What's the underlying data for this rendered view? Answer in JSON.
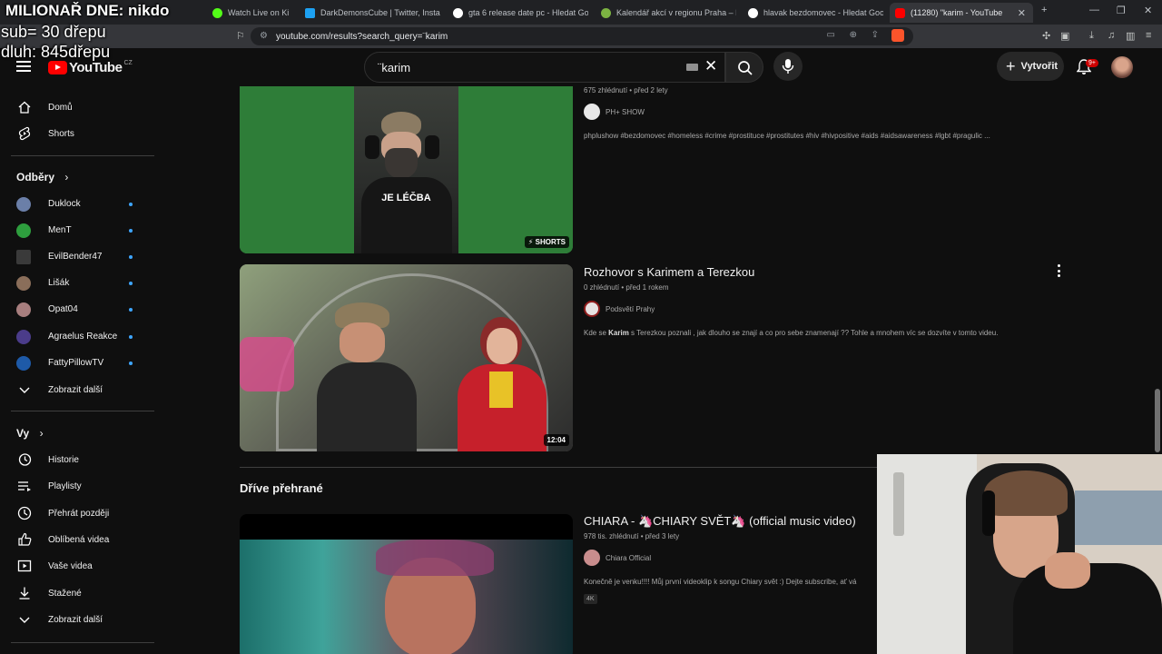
{
  "overlay": {
    "title": "MILIONAŘ DNE: nikdo",
    "line1": "sub= 30 dřepu",
    "line2": "dluh: 845dřepu"
  },
  "browser": {
    "tabs": [
      {
        "label": "Watch Live on Ki",
        "color": "#53fc18"
      },
      {
        "label": "DarkDemonsCube | Twitter, Instagra",
        "color": "#1da1f2"
      },
      {
        "label": "gta 6 release date pc - Hledat Goog",
        "color": "#ffffff"
      },
      {
        "label": "Kalendář akcí v regionu Praha – Kudy",
        "color": "#7cb342"
      },
      {
        "label": "hlavak bezdomovec - Hledat Google",
        "color": "#ffffff"
      },
      {
        "label": "(11280) \"karim - YouTube",
        "color": "#ff0000"
      }
    ],
    "url": "youtube.com/results?search_query=¨karim"
  },
  "header": {
    "logo_text": "YouTube",
    "logo_country": "CZ",
    "search_value": "¨karim",
    "create_label": "Vytvořit",
    "notification_count": "9+"
  },
  "sidebar": {
    "main": [
      {
        "label": "Domů",
        "icon": "home-icon"
      },
      {
        "label": "Shorts",
        "icon": "shorts-icon"
      }
    ],
    "subscriptions_heading": "Odběry",
    "subscriptions": [
      {
        "label": "Duklock",
        "color": "#6b7fa8"
      },
      {
        "label": "MenT",
        "color": "#2e9e3e"
      },
      {
        "label": "EvilBender47",
        "color": "#3a3a3a"
      },
      {
        "label": "Lišák",
        "color": "#8a6e5a"
      },
      {
        "label": "Opat04",
        "color": "#a77e7e"
      },
      {
        "label": "Agraelus Reakce",
        "color": "#4b3c8a"
      },
      {
        "label": "FattyPillowTV",
        "color": "#1e5aa8"
      }
    ],
    "show_more": "Zobrazit další",
    "you_heading": "Vy",
    "you_items": [
      {
        "label": "Historie",
        "icon": "history-icon"
      },
      {
        "label": "Playlisty",
        "icon": "playlists-icon"
      },
      {
        "label": "Přehrát později",
        "icon": "watch-later-icon"
      },
      {
        "label": "Oblíbená videa",
        "icon": "liked-icon"
      },
      {
        "label": "Vaše videa",
        "icon": "your-videos-icon"
      },
      {
        "label": "Stažené",
        "icon": "download-icon"
      }
    ],
    "show_more_2": "Zobrazit další"
  },
  "results": [
    {
      "title": "",
      "meta": "675 zhlédnutí • před 2 lety",
      "channel": "PH+ SHOW",
      "description": "phplushow #bezdomovec #homeless #crime #prostituce #prostitutes #hiv #hivpositive #aids #aidsawareness #lgbt #pragulic ...",
      "thumb_caption": "JE LÉČBA",
      "badge": "SHORTS"
    },
    {
      "title": "Rozhovor s Karimem a Terezkou",
      "meta": "0 zhlédnutí • před 1 rokem",
      "channel": "Podsvětí Prahy",
      "description_pre": "Kde se ",
      "description_bold": "Karim",
      "description_post": " s Terezkou poznali , jak dlouho se znají a co pro sebe znamenají ?? Tohle a mnohem víc se dozvíte v tomto videu.",
      "duration": "12:04"
    }
  ],
  "previously_watched_heading": "Dříve přehrané",
  "previous": {
    "title": "CHIARA - 🦄CHIARY SVĚT🦄 (official music video)",
    "meta": "978 tis. zhlédnutí • před 3 lety",
    "channel": "Chiara Official",
    "description": "Konečně je venku!!!! Můj první videoklip k songu Chiary svět :) Dejte subscribe, ať vá",
    "tag": "4K"
  }
}
